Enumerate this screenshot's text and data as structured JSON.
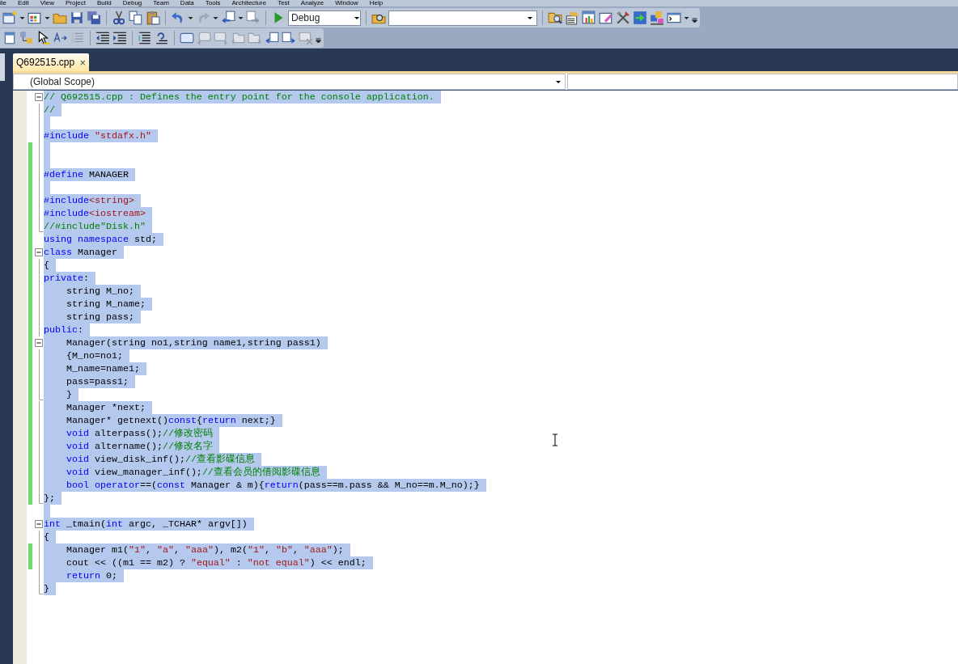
{
  "menu": [
    "ile",
    "Edit",
    "View",
    "Project",
    "Build",
    "Debug",
    "Team",
    "Data",
    "Tools",
    "Architecture",
    "Test",
    "Analyze",
    "Window",
    "Help"
  ],
  "toolbar": {
    "configuration": "Debug"
  },
  "tabs": [
    {
      "label": "Q692515.cpp",
      "selected": true,
      "close": "×"
    }
  ],
  "navigation_bar": {
    "scope": "(Global Scope)"
  },
  "editor": {
    "lines": [
      {
        "collapsible": true,
        "region_end": false,
        "changed": false,
        "selected": true,
        "tokens": [
          {
            "kind": "comment",
            "text": "// Q692515.cpp : Defines the entry point for the console application."
          }
        ]
      },
      {
        "collapsible": false,
        "region_end": false,
        "changed": false,
        "selected": true,
        "tokens": [
          {
            "kind": "comment",
            "text": "//"
          }
        ]
      },
      {
        "collapsible": false,
        "region_end": false,
        "changed": false,
        "selected": true
      },
      {
        "collapsible": false,
        "region_end": false,
        "changed": false,
        "selected": true,
        "tokens": [
          {
            "kind": "keyword",
            "text": "#include"
          },
          {
            "kind": "string",
            "text": "\"stdafx.h\"",
            "space_before": true
          }
        ]
      },
      {
        "collapsible": false,
        "region_end": false,
        "changed": true,
        "selected": true
      },
      {
        "collapsible": false,
        "region_end": false,
        "changed": true,
        "selected": true
      },
      {
        "collapsible": false,
        "region_end": false,
        "changed": true,
        "selected": true,
        "tokens": [
          {
            "kind": "keyword",
            "text": "#define"
          },
          {
            "kind": "plain",
            "text": "MANAGER",
            "space_before": true
          }
        ]
      },
      {
        "collapsible": false,
        "region_end": false,
        "changed": true,
        "selected": true
      },
      {
        "collapsible": false,
        "region_end": false,
        "changed": true,
        "selected": true,
        "tokens": [
          {
            "kind": "keyword",
            "text": "#include"
          },
          {
            "kind": "string",
            "text": "<string>"
          }
        ]
      },
      {
        "collapsible": false,
        "region_end": false,
        "changed": true,
        "selected": true,
        "tokens": [
          {
            "kind": "keyword",
            "text": "#include"
          },
          {
            "kind": "string",
            "text": "<iostream>"
          }
        ]
      },
      {
        "collapsible": false,
        "region_end": true,
        "changed": true,
        "selected": true,
        "tokens": [
          {
            "kind": "comment",
            "text": "//#include\"Disk.h\""
          }
        ]
      },
      {
        "collapsible": false,
        "region_end": false,
        "changed": true,
        "selected": true,
        "tokens": [
          {
            "kind": "keyword",
            "text": "using"
          },
          {
            "kind": "keyword",
            "text": "namespace",
            "space_before": true
          },
          {
            "kind": "plain",
            "text": "std;",
            "space_before": true
          }
        ]
      },
      {
        "collapsible": true,
        "region_end": false,
        "changed": true,
        "selected": true,
        "tokens": [
          {
            "kind": "keyword",
            "text": "class"
          },
          {
            "kind": "plain",
            "text": "Manager",
            "space_before": true
          }
        ]
      },
      {
        "collapsible": false,
        "region_end": false,
        "changed": true,
        "selected": true,
        "tokens": [
          {
            "kind": "plain",
            "text": "{"
          }
        ]
      },
      {
        "collapsible": false,
        "region_end": false,
        "changed": true,
        "selected": true,
        "tokens": [
          {
            "kind": "keyword",
            "text": "private"
          },
          {
            "kind": "plain",
            "text": ":"
          }
        ]
      },
      {
        "collapsible": false,
        "region_end": false,
        "changed": true,
        "selected": true,
        "indent": true,
        "tokens": [
          {
            "kind": "plain",
            "text": "string M_no;"
          }
        ]
      },
      {
        "collapsible": false,
        "region_end": false,
        "changed": true,
        "selected": true,
        "indent": true,
        "tokens": [
          {
            "kind": "plain",
            "text": "string M_name;"
          }
        ]
      },
      {
        "collapsible": false,
        "region_end": false,
        "changed": true,
        "selected": true,
        "indent": true,
        "tokens": [
          {
            "kind": "plain",
            "text": "string pass;"
          }
        ]
      },
      {
        "collapsible": false,
        "region_end": false,
        "changed": true,
        "selected": true,
        "tokens": [
          {
            "kind": "keyword",
            "text": "public"
          },
          {
            "kind": "plain",
            "text": ":"
          }
        ]
      },
      {
        "collapsible": true,
        "region_end": false,
        "changed": true,
        "selected": true,
        "indent": true,
        "tokens": [
          {
            "kind": "plain",
            "text": "Manager(string no1,string name1,string pass1)"
          }
        ]
      },
      {
        "collapsible": false,
        "region_end": false,
        "changed": true,
        "selected": true,
        "indent": true,
        "tokens": [
          {
            "kind": "plain",
            "text": "{M_no=no1;"
          }
        ]
      },
      {
        "collapsible": false,
        "region_end": false,
        "changed": true,
        "selected": true,
        "indent": true,
        "tokens": [
          {
            "kind": "plain",
            "text": "M_name=name1;"
          }
        ]
      },
      {
        "collapsible": false,
        "region_end": false,
        "changed": true,
        "selected": true,
        "indent": true,
        "tokens": [
          {
            "kind": "plain",
            "text": "pass=pass1;"
          }
        ]
      },
      {
        "collapsible": false,
        "region_end": true,
        "changed": true,
        "selected": true,
        "indent": true,
        "tokens": [
          {
            "kind": "plain",
            "text": "}"
          }
        ]
      },
      {
        "collapsible": false,
        "region_end": false,
        "changed": true,
        "selected": true,
        "indent": true,
        "tokens": [
          {
            "kind": "plain",
            "text": "Manager *next;"
          }
        ]
      },
      {
        "collapsible": false,
        "region_end": false,
        "changed": true,
        "selected": true,
        "indent": true,
        "tokens": [
          {
            "kind": "plain",
            "text": "Manager* getnext()"
          },
          {
            "kind": "keyword",
            "text": "const"
          },
          {
            "kind": "plain",
            "text": "{"
          },
          {
            "kind": "keyword",
            "text": "return"
          },
          {
            "kind": "plain",
            "text": "next;}",
            "space_before": true
          }
        ]
      },
      {
        "collapsible": false,
        "region_end": false,
        "changed": true,
        "selected": true,
        "indent": true,
        "tokens": [
          {
            "kind": "keyword",
            "text": "void"
          },
          {
            "kind": "plain",
            "text": "alterpass();",
            "space_before": true
          },
          {
            "kind": "comment",
            "text": "//修改密码"
          }
        ]
      },
      {
        "collapsible": false,
        "region_end": false,
        "changed": true,
        "selected": true,
        "indent": true,
        "tokens": [
          {
            "kind": "keyword",
            "text": "void"
          },
          {
            "kind": "plain",
            "text": "altername();",
            "space_before": true
          },
          {
            "kind": "comment",
            "text": "//修改名字"
          }
        ]
      },
      {
        "collapsible": false,
        "region_end": false,
        "changed": true,
        "selected": true,
        "indent": true,
        "tokens": [
          {
            "kind": "keyword",
            "text": "void"
          },
          {
            "kind": "plain",
            "text": "view_disk_inf();",
            "space_before": true
          },
          {
            "kind": "comment",
            "text": "//查看影碟信息"
          }
        ]
      },
      {
        "collapsible": false,
        "region_end": false,
        "changed": true,
        "selected": true,
        "indent": true,
        "tokens": [
          {
            "kind": "keyword",
            "text": "void"
          },
          {
            "kind": "plain",
            "text": "view_manager_inf();",
            "space_before": true
          },
          {
            "kind": "comment",
            "text": "//查看会员的借阅影碟信息"
          }
        ]
      },
      {
        "collapsible": false,
        "region_end": false,
        "changed": true,
        "selected": true,
        "indent": true,
        "tokens": [
          {
            "kind": "keyword",
            "text": "bool"
          },
          {
            "kind": "keyword",
            "text": "operator",
            "space_before": true
          },
          {
            "kind": "plain",
            "text": "==("
          },
          {
            "kind": "keyword",
            "text": "const"
          },
          {
            "kind": "plain",
            "text": "Manager & m){",
            "space_before": true
          },
          {
            "kind": "keyword",
            "text": "return"
          },
          {
            "kind": "plain",
            "text": "(pass==m.pass && M_no==m.M_no);}"
          }
        ]
      },
      {
        "collapsible": false,
        "region_end": true,
        "changed": true,
        "selected": true,
        "tokens": [
          {
            "kind": "plain",
            "text": "};"
          }
        ]
      },
      {
        "collapsible": false,
        "region_end": false,
        "changed": false,
        "selected": true
      },
      {
        "collapsible": true,
        "region_end": false,
        "changed": false,
        "selected": true,
        "tokens": [
          {
            "kind": "keyword",
            "text": "int"
          },
          {
            "kind": "plain",
            "text": "_tmain(",
            "space_before": true
          },
          {
            "kind": "keyword",
            "text": "int"
          },
          {
            "kind": "plain",
            "text": "argc, _TCHAR* argv[])",
            "space_before": true
          }
        ]
      },
      {
        "collapsible": false,
        "region_end": false,
        "changed": false,
        "selected": true,
        "tokens": [
          {
            "kind": "plain",
            "text": "{"
          }
        ]
      },
      {
        "collapsible": false,
        "region_end": false,
        "changed": true,
        "selected": true,
        "indent": true,
        "tokens": [
          {
            "kind": "plain",
            "text": "Manager m1("
          },
          {
            "kind": "string",
            "text": "\"1\""
          },
          {
            "kind": "plain",
            "text": ","
          },
          {
            "kind": "string",
            "text": "\"a\"",
            "space_before": true
          },
          {
            "kind": "plain",
            "text": ","
          },
          {
            "kind": "string",
            "text": "\"aaa\"",
            "space_before": true
          },
          {
            "kind": "plain",
            "text": "), m2("
          },
          {
            "kind": "string",
            "text": "\"1\""
          },
          {
            "kind": "plain",
            "text": ","
          },
          {
            "kind": "string",
            "text": "\"b\"",
            "space_before": true
          },
          {
            "kind": "plain",
            "text": ","
          },
          {
            "kind": "string",
            "text": "\"aaa\"",
            "space_before": true
          },
          {
            "kind": "plain",
            "text": ");"
          }
        ]
      },
      {
        "collapsible": false,
        "region_end": false,
        "changed": true,
        "selected": true,
        "indent": true,
        "tokens": [
          {
            "kind": "plain",
            "text": "cout << ((m1 == m2) ?"
          },
          {
            "kind": "string",
            "text": "\"equal\"",
            "space_before": true
          },
          {
            "kind": "plain",
            "text": ":",
            "space_before": true
          },
          {
            "kind": "string",
            "text": "\"not equal\"",
            "space_before": true
          },
          {
            "kind": "plain",
            "text": ") << endl;"
          }
        ]
      },
      {
        "collapsible": false,
        "region_end": false,
        "changed": false,
        "selected": true,
        "indent": true,
        "tokens": [
          {
            "kind": "keyword",
            "text": "return"
          },
          {
            "kind": "plain",
            "text": "0;",
            "space_before": true
          }
        ]
      },
      {
        "collapsible": false,
        "region_end": true,
        "changed": false,
        "selected": true,
        "tokens": [
          {
            "kind": "plain",
            "text": "}"
          }
        ]
      }
    ]
  }
}
